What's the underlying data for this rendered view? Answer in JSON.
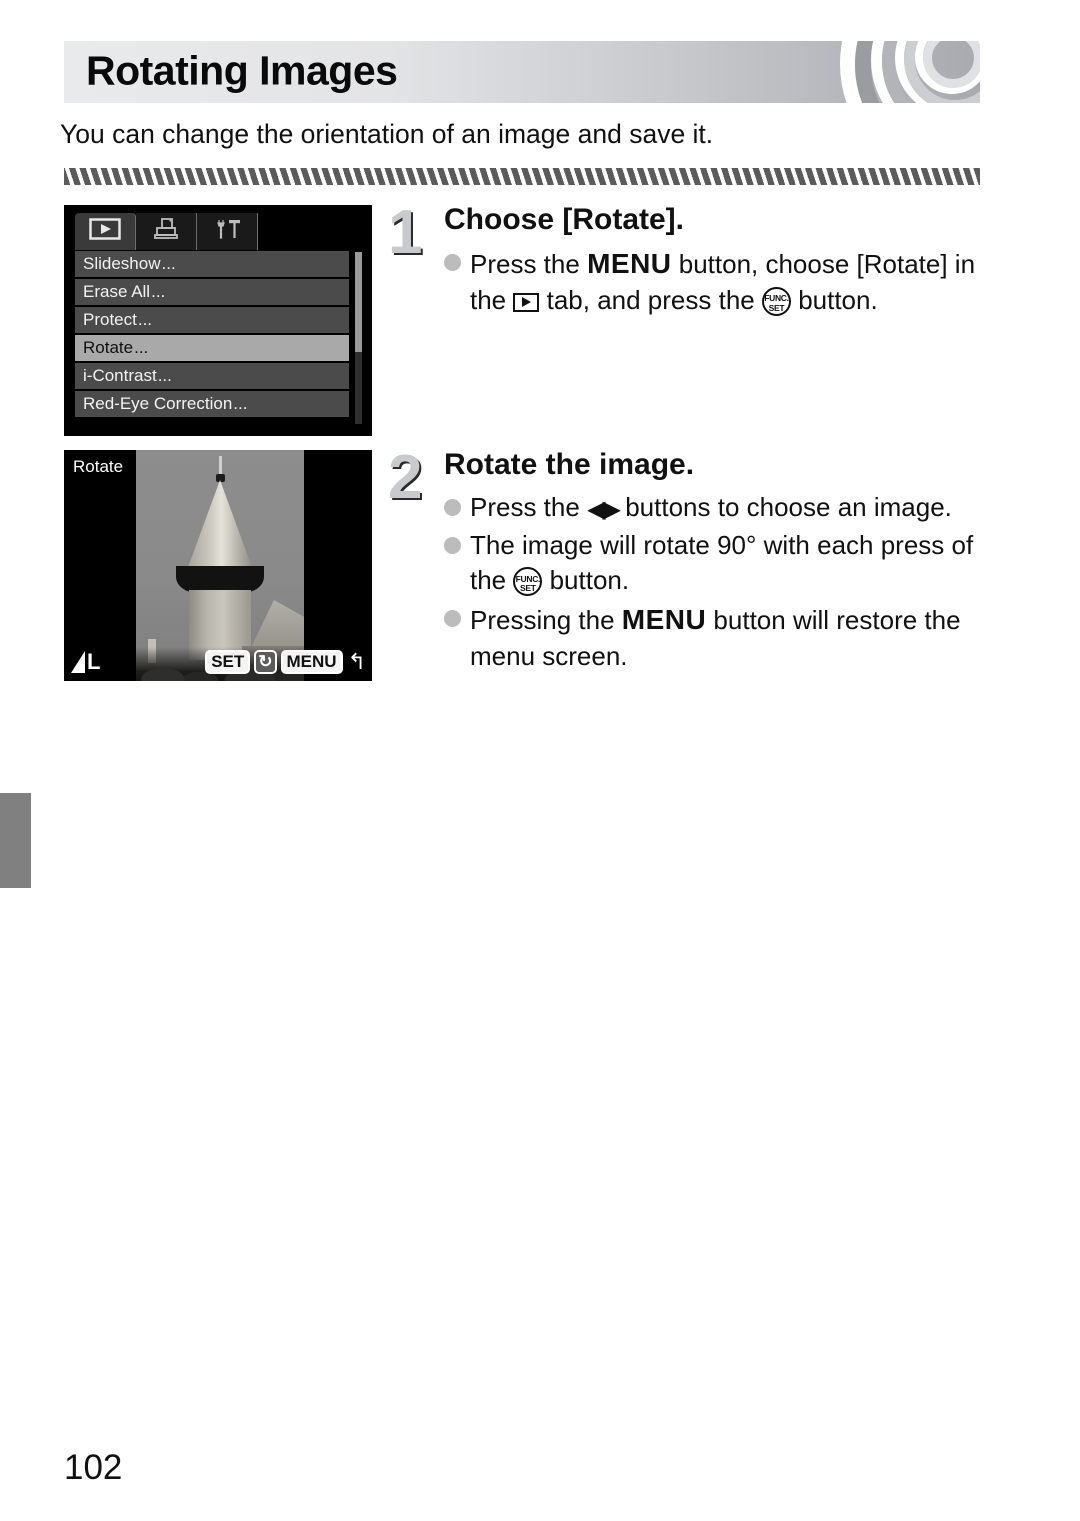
{
  "page": {
    "title": "Rotating Images",
    "intro": "You can change the orientation of an image and save it.",
    "number": "102"
  },
  "menu_screen": {
    "tabs": [
      {
        "name": "playback-tab",
        "icon": "play-icon",
        "active": true
      },
      {
        "name": "print-tab",
        "icon": "printer-icon",
        "active": false
      },
      {
        "name": "settings-tab",
        "icon": "wrench-hammer-icon",
        "active": false
      }
    ],
    "items": [
      {
        "label": "Slideshow",
        "ellipsis": "...",
        "selected": false
      },
      {
        "label": "Erase All",
        "ellipsis": "...",
        "selected": false
      },
      {
        "label": "Protect",
        "ellipsis": "...",
        "selected": false
      },
      {
        "label": "Rotate",
        "ellipsis": "...",
        "selected": true
      },
      {
        "label": "i-Contrast",
        "ellipsis": "...",
        "selected": false
      },
      {
        "label": "Red-Eye Correction",
        "ellipsis": "...",
        "selected": false
      }
    ]
  },
  "rotate_screen": {
    "label": "Rotate",
    "quality_letter": "L",
    "buttons": {
      "set": "SET",
      "rotate_icon": "↻",
      "menu": "MENU",
      "return_arrow": "↰"
    }
  },
  "steps": [
    {
      "number": "1",
      "heading": "Choose [Rotate].",
      "bullets": [
        {
          "segments": [
            {
              "type": "text",
              "value": "Press the "
            },
            {
              "type": "keyword",
              "value": "MENU"
            },
            {
              "type": "text",
              "value": " button, choose [Rotate] in the "
            },
            {
              "type": "icon",
              "value": "play-icon"
            },
            {
              "type": "text",
              "value": " tab, and press the "
            },
            {
              "type": "icon",
              "value": "func-set-icon"
            },
            {
              "type": "text",
              "value": " button."
            }
          ],
          "plain": "Press the MENU button, choose [Rotate] in the ▶ tab, and press the FUNC./SET button."
        }
      ]
    },
    {
      "number": "2",
      "heading": "Rotate the image.",
      "bullets": [
        {
          "segments": [
            {
              "type": "text",
              "value": "Press the "
            },
            {
              "type": "icon",
              "value": "left-right-arrows-icon"
            },
            {
              "type": "text",
              "value": " buttons to choose an image."
            }
          ],
          "plain": "Press the ◀▶ buttons to choose an image."
        },
        {
          "segments": [
            {
              "type": "text",
              "value": "The image will rotate 90° with each press of the "
            },
            {
              "type": "icon",
              "value": "func-set-icon"
            },
            {
              "type": "text",
              "value": " button."
            }
          ],
          "plain": "The image will rotate 90° with each press of the FUNC./SET button."
        },
        {
          "segments": [
            {
              "type": "text",
              "value": "Pressing the "
            },
            {
              "type": "keyword",
              "value": "MENU"
            },
            {
              "type": "text",
              "value": " button will restore the menu screen."
            }
          ],
          "plain": "Pressing the MENU button will restore the menu screen."
        }
      ]
    }
  ],
  "func_set_icon": {
    "line1": "FUNC.",
    "line2": "SET"
  },
  "colors": {
    "title_bar_light": "#e9eaec",
    "title_bar_dark": "#a9aab0",
    "menu_row": "#4b4b4b",
    "menu_row_selected": "#a9a9a9",
    "bullet": "#bcbcbc",
    "step_number": "#c9cacd",
    "edge_tab": "#808080"
  }
}
